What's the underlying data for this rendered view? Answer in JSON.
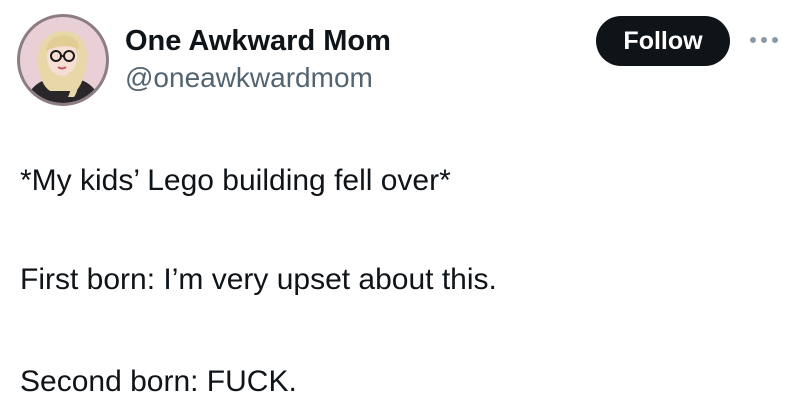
{
  "author": {
    "name": "One Awkward Mom",
    "handle": "@oneawkwardmom",
    "avatar_icon": "profile-avatar"
  },
  "actions": {
    "follow_label": "Follow",
    "more_icon": "more-horizontal-icon"
  },
  "tweet": {
    "lines": [
      "*My kids’ Lego building fell over*",
      "First born: I’m very upset about this.",
      "Second born: FUCK."
    ]
  },
  "colors": {
    "text": "#0f1419",
    "secondary": "#536471",
    "button_bg": "#0f1419",
    "button_text": "#ffffff",
    "avatar_bg": "#e9cfd6"
  }
}
